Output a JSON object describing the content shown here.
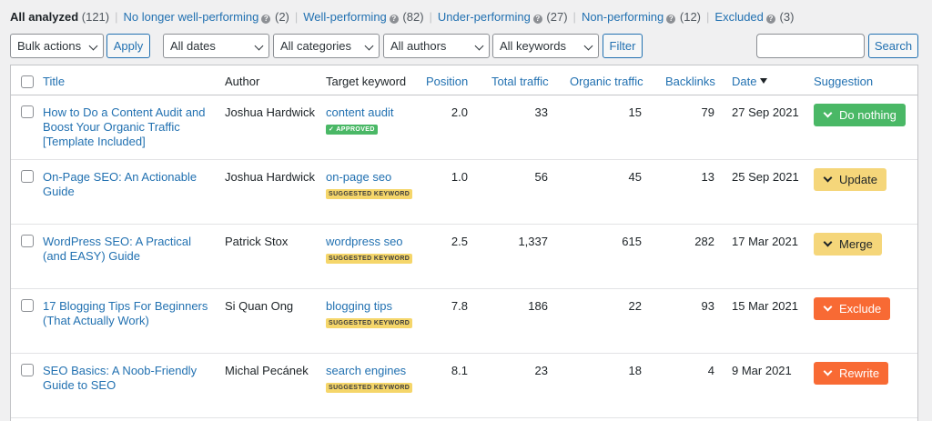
{
  "status_tabs": [
    {
      "label": "All analyzed",
      "count": "(121)",
      "current": true,
      "help": false
    },
    {
      "label": "No longer well-performing",
      "count": "(2)",
      "current": false,
      "help": true
    },
    {
      "label": "Well-performing",
      "count": "(82)",
      "current": false,
      "help": true
    },
    {
      "label": "Under-performing",
      "count": "(27)",
      "current": false,
      "help": true
    },
    {
      "label": "Non-performing",
      "count": "(12)",
      "current": false,
      "help": true
    },
    {
      "label": "Excluded",
      "count": "(3)",
      "current": false,
      "help": true
    }
  ],
  "toolbar": {
    "bulk_actions": "Bulk actions",
    "apply": "Apply",
    "dates": "All dates",
    "categories": "All categories",
    "authors": "All authors",
    "keywords": "All keywords",
    "filter": "Filter",
    "search_value": "",
    "search": "Search"
  },
  "columns": {
    "title": "Title",
    "author": "Author",
    "target_keyword": "Target keyword",
    "position": "Position",
    "total_traffic": "Total traffic",
    "organic_traffic": "Organic traffic",
    "backlinks": "Backlinks",
    "date": "Date",
    "suggestion": "Suggestion"
  },
  "rows": [
    {
      "title": "How to Do a Content Audit and Boost Your Organic Traffic [Template Included]",
      "author": "Joshua Hardwick",
      "keyword": "content audit",
      "badge": "✓ APPROVED",
      "badge_type": "approved",
      "position": "2.0",
      "total_traffic": "33",
      "organic_traffic": "15",
      "backlinks": "79",
      "date": "27 Sep 2021",
      "suggestion": "Do nothing",
      "suggestion_color": "green"
    },
    {
      "title": "On-Page SEO: An Actionable Guide",
      "author": "Joshua Hardwick",
      "keyword": "on-page seo",
      "badge": "SUGGESTED KEYWORD",
      "badge_type": "suggested",
      "position": "1.0",
      "total_traffic": "56",
      "organic_traffic": "45",
      "backlinks": "13",
      "date": "25 Sep 2021",
      "suggestion": "Update",
      "suggestion_color": "yellow"
    },
    {
      "title": "WordPress SEO: A Practical (and EASY) Guide",
      "author": "Patrick Stox",
      "keyword": "wordpress seo",
      "badge": "SUGGESTED KEYWORD",
      "badge_type": "suggested",
      "position": "2.5",
      "total_traffic": "1,337",
      "organic_traffic": "615",
      "backlinks": "282",
      "date": "17 Mar 2021",
      "suggestion": "Merge",
      "suggestion_color": "yellow"
    },
    {
      "title": "17 Blogging Tips For Beginners (That Actually Work)",
      "author": "Si Quan Ong",
      "keyword": "blogging tips",
      "badge": "SUGGESTED KEYWORD",
      "badge_type": "suggested",
      "position": "7.8",
      "total_traffic": "186",
      "organic_traffic": "22",
      "backlinks": "93",
      "date": "15 Mar 2021",
      "suggestion": "Exclude",
      "suggestion_color": "orange"
    },
    {
      "title": "SEO Basics: A Noob-Friendly Guide to SEO",
      "author": "Michal Pecánek",
      "keyword": "search engines",
      "badge": "SUGGESTED KEYWORD",
      "badge_type": "suggested",
      "position": "8.1",
      "total_traffic": "23",
      "organic_traffic": "18",
      "backlinks": "4",
      "date": "9 Mar 2021",
      "suggestion": "Rewrite",
      "suggestion_color": "orange"
    }
  ],
  "colors": {
    "link": "#2271b1",
    "green": "#4ab866",
    "yellow": "#f5d67a",
    "orange": "#f86a34"
  }
}
